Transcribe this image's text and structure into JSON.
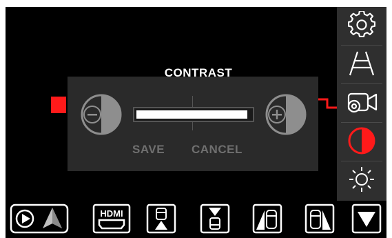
{
  "dialog": {
    "title": "CONTRAST",
    "save_label": "SAVE",
    "cancel_label": "CANCEL",
    "contrast_level": 0.97
  },
  "sidebar": {
    "items": [
      {
        "icon": "gear-icon"
      },
      {
        "icon": "lane-guide-icon"
      },
      {
        "icon": "camera-settings-icon"
      },
      {
        "icon": "contrast-icon",
        "active": true
      },
      {
        "icon": "brightness-icon"
      }
    ]
  },
  "bottom_bar": {
    "items": [
      {
        "icon": "carplay-android-auto-icon"
      },
      {
        "icon": "hdmi-icon",
        "text": "HDMI"
      },
      {
        "icon": "rear-view-icon"
      },
      {
        "icon": "front-view-icon"
      },
      {
        "icon": "left-side-view-icon"
      },
      {
        "icon": "right-side-view-icon"
      },
      {
        "icon": "collapse-arrow-icon"
      }
    ]
  },
  "colors": {
    "accent_red": "#ff1a1a",
    "sidebar_bg": "#2f2f2f",
    "dialog_bg": "#2a2a2a",
    "disabled_text": "#6f6f6f"
  }
}
